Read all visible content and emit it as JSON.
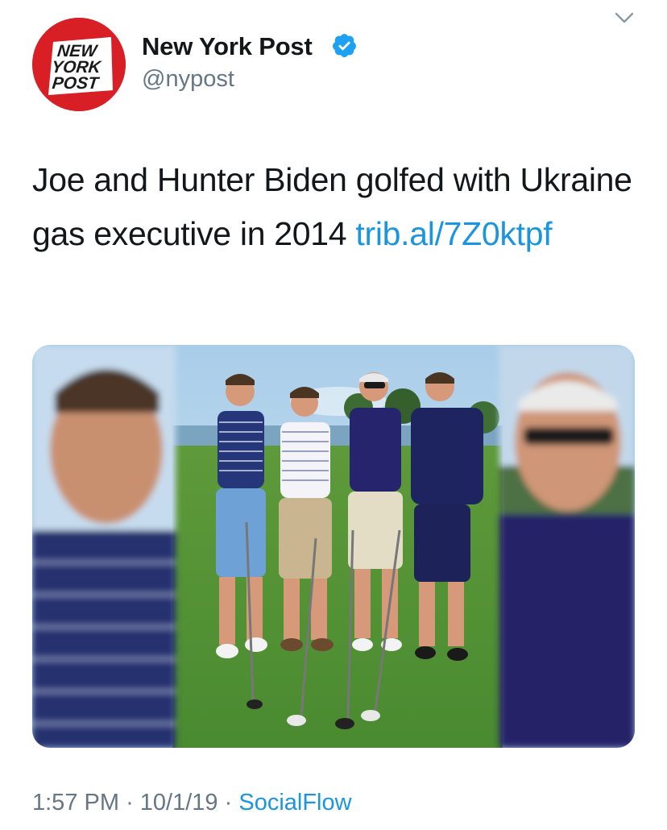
{
  "tweet": {
    "display_name": "New York Post",
    "handle": "@nypost",
    "verified": true,
    "avatar_logo_lines": [
      "NEW",
      "YORK",
      "POST"
    ],
    "text": "Joe and Hunter Biden golfed with Ukraine gas executive in 2014",
    "link": "trib.al/7Z0ktpf",
    "time": "1:57 PM",
    "date": "10/1/19",
    "separator": "·",
    "source": "SocialFlow",
    "media_alt": "Photo of four men standing with golf clubs on a golf course, flanked by blurred close-ups of two of them"
  },
  "icons": {
    "chevron": "chevron-down-icon",
    "verified": "verified-badge-icon"
  },
  "colors": {
    "brand_red": "#d81f26",
    "link_blue": "#1b95e0",
    "muted_gray": "#657786",
    "text": "#14171a"
  }
}
